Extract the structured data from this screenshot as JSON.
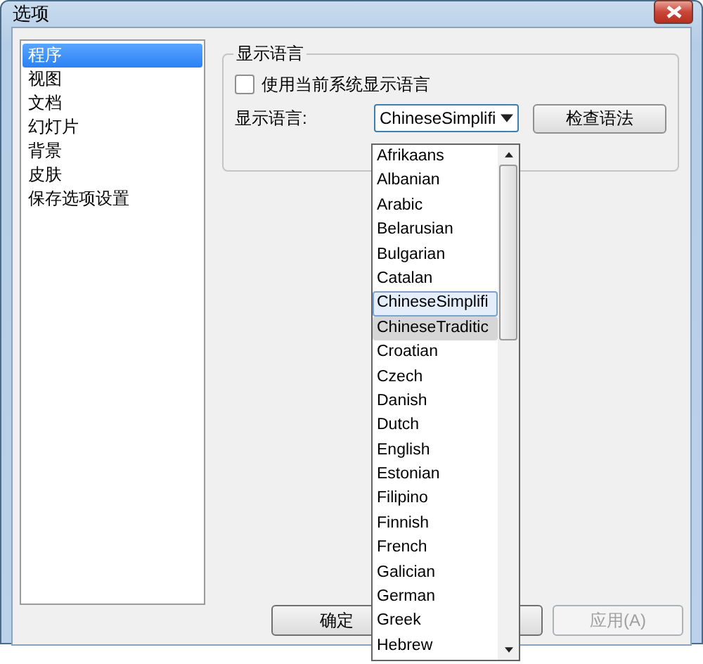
{
  "window": {
    "title": "选项"
  },
  "sidebar": {
    "items": [
      {
        "label": "程序",
        "selected": true
      },
      {
        "label": "视图",
        "selected": false
      },
      {
        "label": "文档",
        "selected": false
      },
      {
        "label": "幻灯片",
        "selected": false
      },
      {
        "label": "背景",
        "selected": false
      },
      {
        "label": "皮肤",
        "selected": false
      },
      {
        "label": "保存选项设置",
        "selected": false
      }
    ]
  },
  "group": {
    "title": "显示语言",
    "checkbox": {
      "label": "使用当前系统显示语言",
      "checked": false
    },
    "language_label": "显示语言:",
    "language_combo": {
      "value": "ChineseSimplifi",
      "expanded": true
    },
    "check_button": "检查语法"
  },
  "dropdown": {
    "items": [
      {
        "label": "Afrikaans",
        "selected": false,
        "hovered": false
      },
      {
        "label": "Albanian",
        "selected": false,
        "hovered": false
      },
      {
        "label": "Arabic",
        "selected": false,
        "hovered": false
      },
      {
        "label": "Belarusian",
        "selected": false,
        "hovered": false
      },
      {
        "label": "Bulgarian",
        "selected": false,
        "hovered": false
      },
      {
        "label": "Catalan",
        "selected": false,
        "hovered": false
      },
      {
        "label": "ChineseSimplifi",
        "selected": true,
        "hovered": false
      },
      {
        "label": "ChineseTraditic",
        "selected": false,
        "hovered": true
      },
      {
        "label": "Croatian",
        "selected": false,
        "hovered": false
      },
      {
        "label": "Czech",
        "selected": false,
        "hovered": false
      },
      {
        "label": "Danish",
        "selected": false,
        "hovered": false
      },
      {
        "label": "Dutch",
        "selected": false,
        "hovered": false
      },
      {
        "label": "English",
        "selected": false,
        "hovered": false
      },
      {
        "label": "Estonian",
        "selected": false,
        "hovered": false
      },
      {
        "label": "Filipino",
        "selected": false,
        "hovered": false
      },
      {
        "label": "Finnish",
        "selected": false,
        "hovered": false
      },
      {
        "label": "French",
        "selected": false,
        "hovered": false
      },
      {
        "label": "Galician",
        "selected": false,
        "hovered": false
      },
      {
        "label": "German",
        "selected": false,
        "hovered": false
      },
      {
        "label": "Greek",
        "selected": false,
        "hovered": false
      },
      {
        "label": "Hebrew",
        "selected": false,
        "hovered": false
      }
    ]
  },
  "buttons": [
    {
      "label": "确定",
      "disabled": false
    },
    {
      "disabled": false
    },
    {
      "label": "应用(A)",
      "disabled": true
    }
  ]
}
